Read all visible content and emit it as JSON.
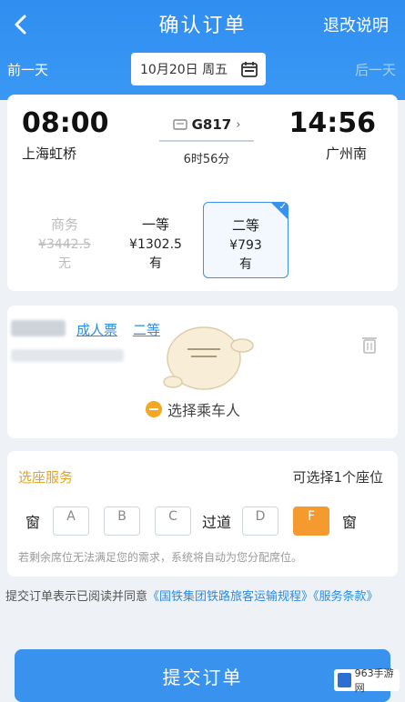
{
  "header": {
    "title": "确认订单",
    "refund_link": "退改说明",
    "prev_day": "前一天",
    "date": "10月20日 周五",
    "next_day": "后一天"
  },
  "trip": {
    "departure_time": "08:00",
    "departure_station": "上海虹桥",
    "arrival_time": "14:56",
    "arrival_station": "广州南",
    "train_no": "G817",
    "duration": "6时56分"
  },
  "seat_classes": [
    {
      "class": "商务",
      "price": "¥3442.5",
      "status": "无"
    },
    {
      "class": "一等",
      "price": "¥1302.5",
      "status": "有"
    },
    {
      "class": "二等",
      "price": "¥793",
      "status": "有"
    }
  ],
  "passenger": {
    "ticket_type": "成人票",
    "seat_class": "二等",
    "choose_label": "选择乘车人"
  },
  "seat_service": {
    "title": "选座服务",
    "available": "可选择1个座位",
    "left_label": "窗",
    "aisle_label": "过道",
    "right_label": "窗",
    "seats": [
      "A",
      "B",
      "C",
      "D",
      "F"
    ],
    "selected": "F",
    "notice": "若剩余席位无法满足您的需求，系统将自动为您分配席位。"
  },
  "agreement": {
    "text": "提交订单表示已阅读并同意",
    "link1": "《国铁集团铁路旅客运输规程》",
    "link2": "《服务条款》"
  },
  "submit_label": "提交订单",
  "watermark": "963手游网",
  "colors": {
    "primary": "#3a92ef",
    "accent": "#f59a2f"
  }
}
